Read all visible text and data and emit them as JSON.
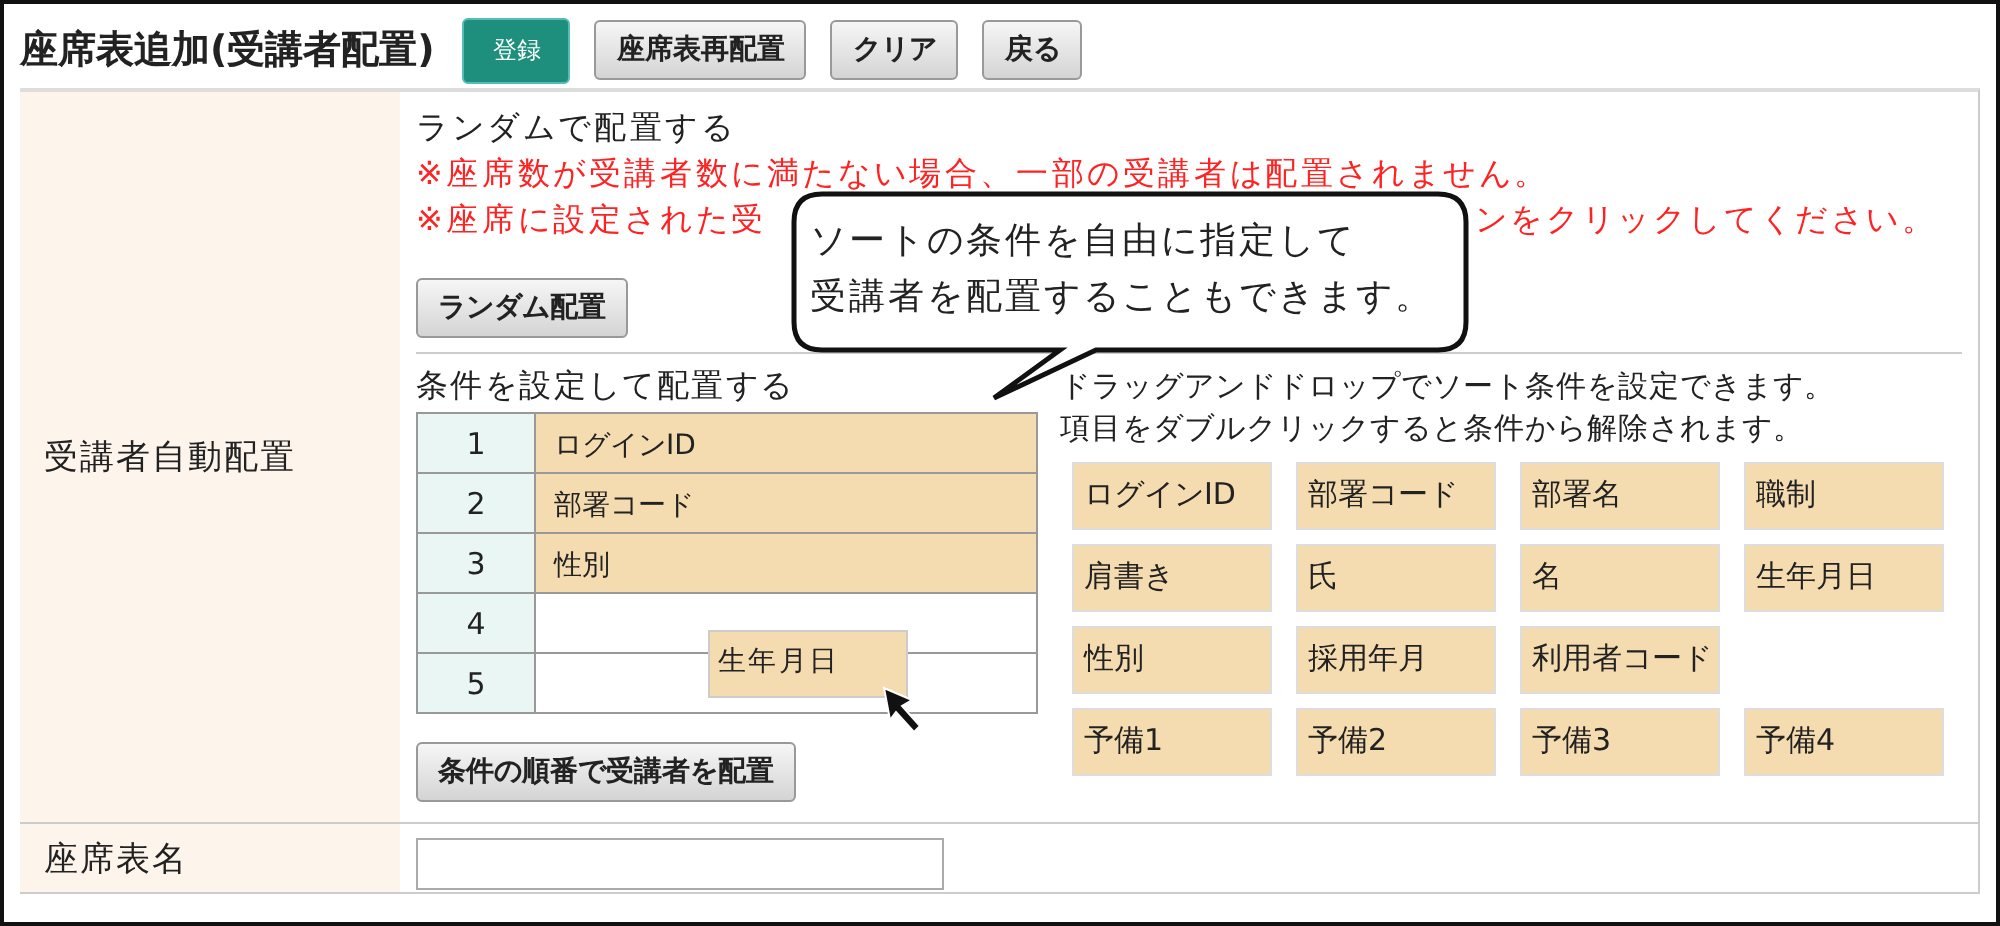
{
  "title": "座席表追加(受講者配置)",
  "buttons": [
    {
      "label": "登録",
      "kind": "primary"
    },
    {
      "label": "座席表再配置",
      "kind": "normal"
    },
    {
      "label": "クリア",
      "kind": "normal"
    },
    {
      "label": "戻る",
      "kind": "normal"
    }
  ],
  "auto_assign": {
    "label": "受講者自動配置",
    "random": {
      "heading": "ランダムで配置する",
      "warning_1": "※座席数が受講者数に満たない場合、一部の受講者は配置されません。",
      "warning_2_start": "※座席に設定された受",
      "warning_2_end": "ンをクリックしてください。",
      "button": "ランダム配置"
    },
    "callout": {
      "lines": [
        "ソートの条件を自由に指定して",
        "受講者を配置することもできます。"
      ]
    },
    "conditions": {
      "heading": "条件を設定して配置する",
      "rows": [
        {
          "number": "1",
          "value": "ログインID"
        },
        {
          "number": "2",
          "value": "部署コード"
        },
        {
          "number": "3",
          "value": "性別"
        },
        {
          "number": "4"
        },
        {
          "number": "5"
        }
      ],
      "dragging_item": "生年月日",
      "button": "条件の順番で受講者を配置",
      "hints": [
        "ドラッグアンドドロップでソート条件を設定できます。",
        "項目をダブルクリックすると条件から解除されます。"
      ],
      "items": [
        [
          "ログインID",
          "部署コード",
          "部署名",
          "職制"
        ],
        [
          "肩書き",
          "氏",
          "名",
          "生年月日"
        ],
        [
          "性別",
          "採用年月",
          "利用者コード"
        ],
        [
          "予備1",
          "予備2",
          "予備3",
          "予備4"
        ]
      ]
    }
  },
  "seat_chart_name": {
    "label": "座席表名"
  }
}
